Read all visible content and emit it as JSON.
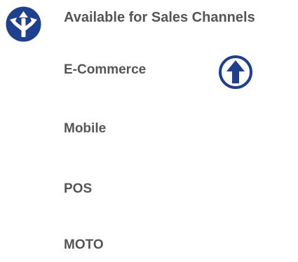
{
  "header": {
    "icon": "split-arrows-icon",
    "title": "Available for Sales Channels"
  },
  "channels": [
    {
      "label": "E-Commerce",
      "badge_icon": "arrow-up-circle-icon"
    },
    {
      "label": "Mobile"
    },
    {
      "label": "POS"
    },
    {
      "label": "MOTO"
    }
  ],
  "colors": {
    "accent": "#1f3f8f",
    "text": "#555555"
  }
}
